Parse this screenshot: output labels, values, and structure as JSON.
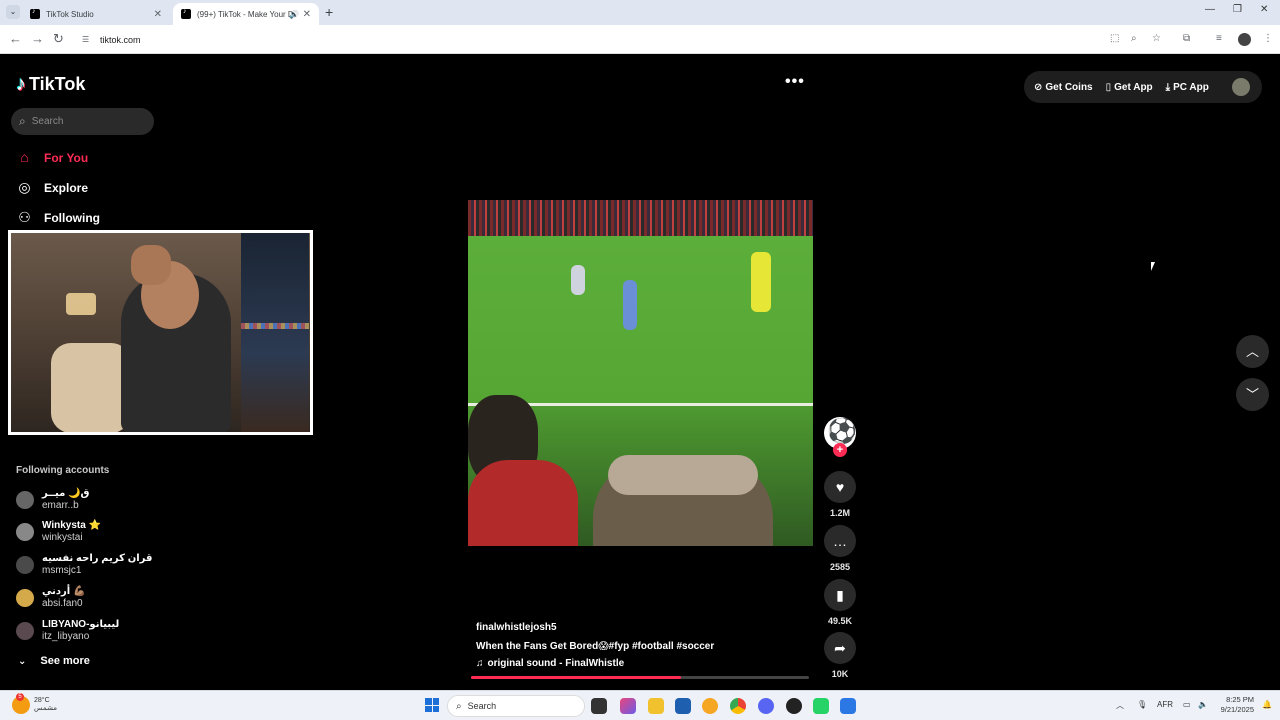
{
  "browser": {
    "tabs": [
      {
        "label": "TikTok Studio"
      },
      {
        "label": "(99+) TikTok - Make Your Day"
      }
    ],
    "url": "tiktok.com"
  },
  "app": {
    "logo_text": "TikTok",
    "search_placeholder": "Search",
    "nav": [
      {
        "label": "For You",
        "icon": "home-icon",
        "active": true
      },
      {
        "label": "Explore",
        "icon": "compass-icon"
      },
      {
        "label": "Following",
        "icon": "user-plus-icon"
      }
    ],
    "following_title": "Following accounts",
    "accounts": [
      {
        "name": "ق🌙 ميــر",
        "handle": "emarr..b"
      },
      {
        "name": "Winkysta ⭐",
        "handle": "winkystai"
      },
      {
        "name": "قران كريم راحه نفسيه",
        "handle": "msmsjc1"
      },
      {
        "name": "أردني 💪🏽",
        "handle": "absi.fan0"
      },
      {
        "name": "LIBYANO-ليبيانو",
        "handle": "itz_libyano"
      }
    ],
    "see_more": "See more",
    "top_actions": {
      "get_coins": "Get Coins",
      "get_app": "Get App",
      "pc_app": "PC App"
    }
  },
  "video": {
    "username": "finalwhistlejosh5",
    "description": "When the Fans Get Bored😱#fyp  #football  #soccer",
    "sound": "original sound - FinalWhistle",
    "progress": 0.62,
    "likes": "1.2M",
    "comments": "2585",
    "saves": "49.5K",
    "shares": "10K"
  },
  "taskbar": {
    "temperature": "28°C",
    "weather_label": "مشمس",
    "search_label": "Search",
    "lang": "AFR",
    "time": "8:25 PM",
    "date": "9/21/2025"
  }
}
